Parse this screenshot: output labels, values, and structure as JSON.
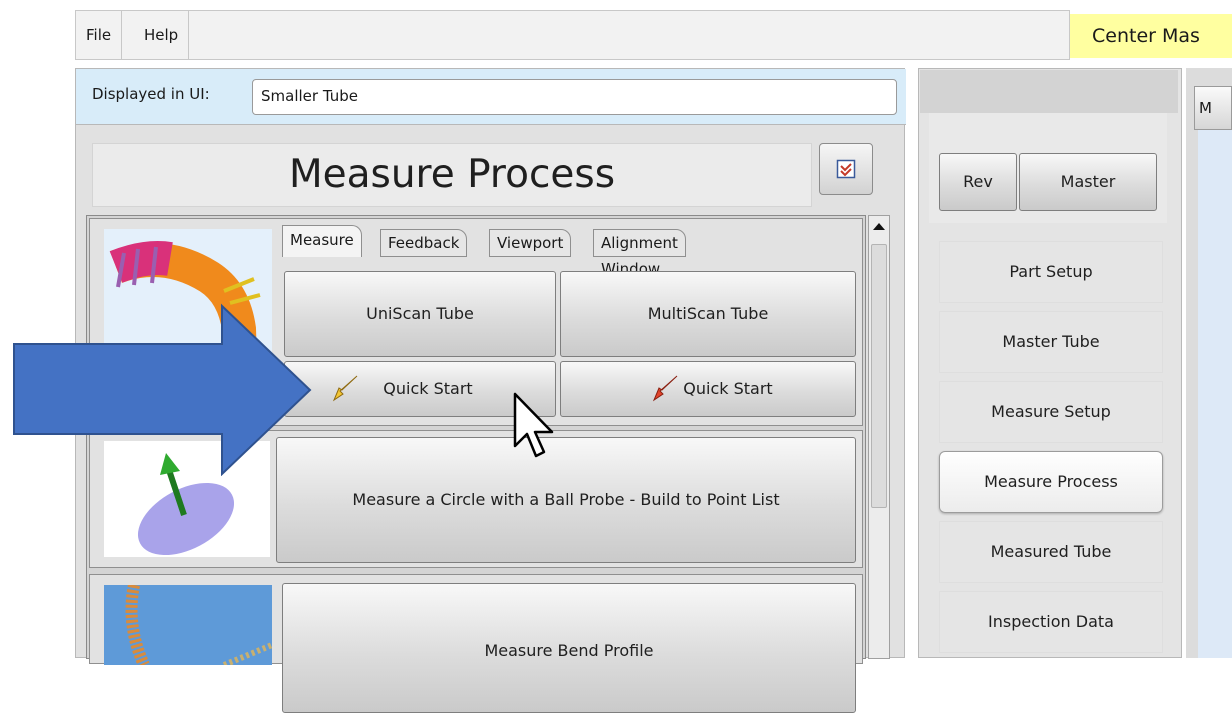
{
  "menu": {
    "file": "File",
    "help": "Help"
  },
  "header_right": "Center Mas",
  "display": {
    "label": "Displayed in UI:",
    "value": "Smaller Tube"
  },
  "panel_title": "Measure Process",
  "tabs": [
    "Measure",
    "Feedback",
    "Viewport",
    "Alignment Window"
  ],
  "buttons": {
    "uniscan": "UniScan Tube",
    "multiscan": "MultiScan Tube",
    "quick_start_1": "Quick Start",
    "quick_start_2": "Quick Start",
    "circle": "Measure a Circle with a Ball Probe - Build to Point List",
    "bend": "Measure Bend Profile"
  },
  "right": {
    "rev": "Rev",
    "master": "Master",
    "nav": [
      "Part Setup",
      "Master Tube",
      "Measure Setup",
      "Measure Process",
      "Measured Tube",
      "Inspection Data"
    ],
    "active_nav": "Measure Process",
    "far_right_label": "M"
  },
  "colors": {
    "arrow": "#4472c4",
    "highlight": "#ffffa0",
    "display_bar": "#d8ecf9"
  }
}
